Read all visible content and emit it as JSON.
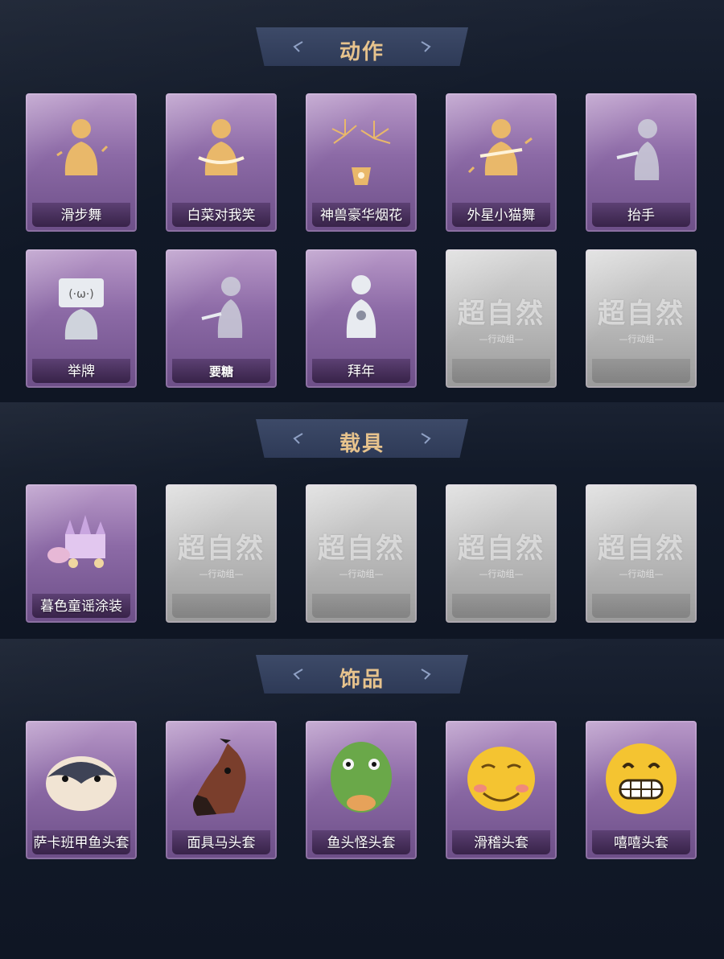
{
  "sections": [
    {
      "title": "动作",
      "items": [
        {
          "label": "滑步舞",
          "icon": "dancing-figure-icon"
        },
        {
          "label": "白菜对我笑",
          "icon": "crossed-arms-figure-icon"
        },
        {
          "label": "神兽豪华烟花",
          "icon": "fireworks-icon"
        },
        {
          "label": "外星小猫舞",
          "icon": "dancing-figure-icon"
        },
        {
          "label": "抬手",
          "icon": "raising-hand-figure-icon"
        },
        {
          "label": "举牌",
          "icon": "holding-sign-figure-icon"
        },
        {
          "label": "要糖",
          "icon": "asking-candy-figure-icon"
        },
        {
          "label": "拜年",
          "icon": "bowing-figure-icon"
        },
        {
          "locked": true
        },
        {
          "locked": true
        }
      ]
    },
    {
      "title": "载具",
      "items": [
        {
          "label": "暮色童谣涂装",
          "icon": "castle-carriage-icon"
        },
        {
          "locked": true
        },
        {
          "locked": true
        },
        {
          "locked": true
        },
        {
          "locked": true
        }
      ]
    },
    {
      "title": "饰品",
      "items": [
        {
          "label": "萨卡班甲鱼头套",
          "icon": "fish-head-icon"
        },
        {
          "label": "面具马头套",
          "icon": "horse-head-icon"
        },
        {
          "label": "鱼头怪头套",
          "icon": "green-fish-head-icon"
        },
        {
          "label": "滑稽头套",
          "icon": "smirk-face-icon"
        },
        {
          "label": "嘻嘻头套",
          "icon": "grin-face-icon"
        }
      ]
    }
  ],
  "placeholder": {
    "title": "超自然",
    "subtitle": "—行动组—"
  }
}
